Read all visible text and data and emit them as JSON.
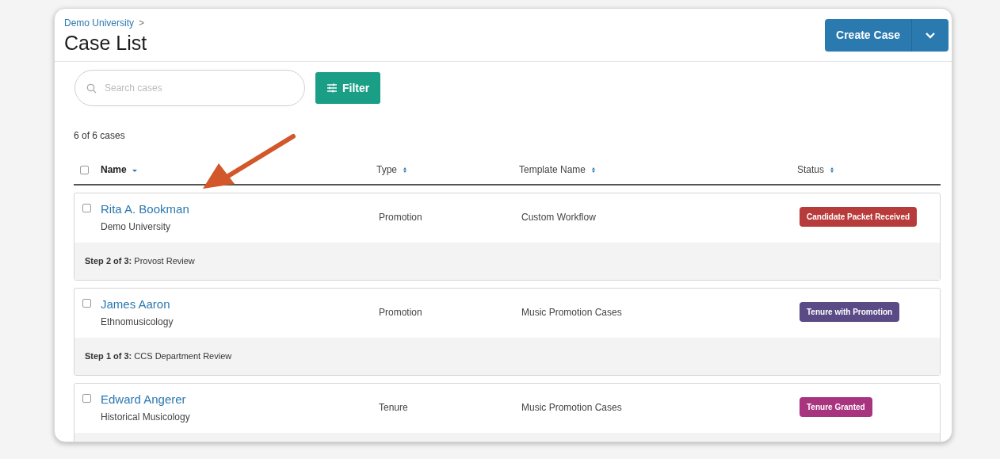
{
  "breadcrumb": {
    "label": "Demo University",
    "separator": ">"
  },
  "title": "Case List",
  "create_button": {
    "label": "Create Case"
  },
  "search": {
    "placeholder": "Search cases"
  },
  "filter_button": {
    "label": "Filter"
  },
  "count": "6 of 6 cases",
  "select_all": {
    "checked": false
  },
  "columns": [
    {
      "label": "Name",
      "sorted": true
    },
    {
      "label": "Type",
      "sorted": false
    },
    {
      "label": "Template Name",
      "sorted": false
    },
    {
      "label": "Status",
      "sorted": false
    }
  ],
  "rows": [
    {
      "name": "Rita A. Bookman",
      "unit": "Demo University",
      "type": "Promotion",
      "template": "Custom Workflow",
      "status": {
        "label": "Candidate Packet Received",
        "color": "#b83b3b"
      },
      "checked": false,
      "step": "**Step 2 of 3:** Provost Review"
    },
    {
      "name": "James Aaron",
      "unit": "Ethnomusicology",
      "type": "Promotion",
      "template": "Music Promotion Cases",
      "status": {
        "label": "Tenure with Promotion",
        "color": "#5a4a86"
      },
      "checked": false,
      "step": "**Step 1 of 3:** CCS Department Review"
    },
    {
      "name": "Edward Angerer",
      "unit": "Historical Musicology",
      "type": "Tenure",
      "template": "Music Promotion Cases",
      "status": {
        "label": "Tenure Granted",
        "color": "#a8337f"
      },
      "checked": false
    }
  ]
}
